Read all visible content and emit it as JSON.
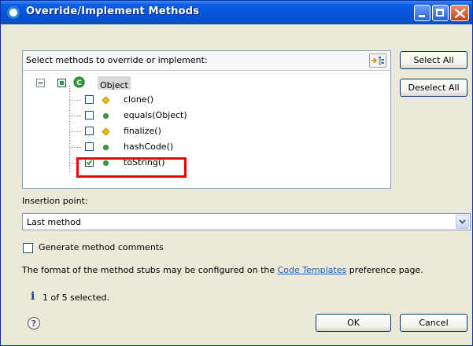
{
  "window": {
    "title": "Override/Implement Methods"
  },
  "methods_panel": {
    "prompt": "Select methods to override or implement:",
    "root": {
      "label": "Object"
    },
    "items": [
      {
        "label": "clone()",
        "visibility": "protected",
        "checked": false
      },
      {
        "label": "equals(Object)",
        "visibility": "public",
        "checked": false
      },
      {
        "label": "finalize()",
        "visibility": "protected",
        "checked": false
      },
      {
        "label": "hashCode()",
        "visibility": "public",
        "checked": false
      },
      {
        "label": "toString()",
        "visibility": "public",
        "checked": true
      }
    ]
  },
  "buttons": {
    "select_all": "Select All",
    "deselect_all": "Deselect All",
    "ok": "OK",
    "cancel": "Cancel"
  },
  "insertion": {
    "label": "Insertion point:",
    "value": "Last method"
  },
  "generate_comments": {
    "label": "Generate method comments",
    "checked": false
  },
  "info": {
    "text_before": "The format of the method stubs may be configured on the ",
    "link": "Code Templates",
    "text_after": " preference page."
  },
  "status": {
    "text": "1 of 5 selected."
  },
  "colors": {
    "titlebar": "#0253d8",
    "highlight_box": "#ff0000",
    "public_method": "#3aa04a",
    "protected_method": "#f0c000",
    "link": "#1c5fbe"
  }
}
